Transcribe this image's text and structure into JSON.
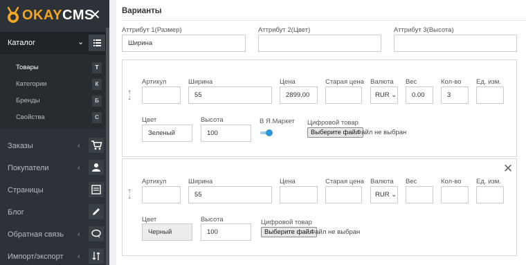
{
  "app": {
    "logo_okay": "OKAY",
    "logo_cms": "CMS"
  },
  "sidebar": {
    "catalog_label": "Каталог",
    "catalog_items": [
      {
        "label": "Товары",
        "letter": "Т"
      },
      {
        "label": "Категории",
        "letter": "К"
      },
      {
        "label": "Бренды",
        "letter": "Б"
      },
      {
        "label": "Свойства",
        "letter": "С"
      }
    ],
    "nav": [
      {
        "label": "Заказы"
      },
      {
        "label": "Покупатели"
      },
      {
        "label": "Страницы"
      },
      {
        "label": "Блог"
      },
      {
        "label": "Обратная связь"
      },
      {
        "label": "Импорт/экспорт"
      }
    ]
  },
  "section": {
    "title": "Варианты",
    "attr1_label": "Аттрибут 1(Размер)",
    "attr1_value": "Ширина",
    "attr2_label": "Аттрибут 2(Цвет)",
    "attr2_value": "",
    "attr3_label": "Аттрибут 3(Высота)",
    "attr3_value": ""
  },
  "labels": {
    "sku": "Артикул",
    "width": "Ширина",
    "price": "Цена",
    "old_price": "Старая цена",
    "currency": "Валюта",
    "weight": "Вес",
    "qty": "Кол-во",
    "unit": "Ед. изм.",
    "color": "Цвет",
    "height": "Высота",
    "yandex": "В Я.Маркет",
    "digital": "Цифровой товар",
    "choose_file": "Выберите файл",
    "no_file": "Файл не выбран"
  },
  "variants": [
    {
      "sku": "",
      "width": "55",
      "price": "2899.00",
      "old_price": "",
      "currency": "RUR",
      "weight": "0.00",
      "qty": "3",
      "unit": "",
      "color": "Зеленый",
      "height": "100",
      "yandex_enabled": true
    },
    {
      "sku": "",
      "width": "55",
      "price": "",
      "old_price": "",
      "currency": "RUR",
      "weight": "",
      "qty": "",
      "unit": "",
      "color": "Черный",
      "height": "100",
      "yandex_enabled": false
    }
  ]
}
